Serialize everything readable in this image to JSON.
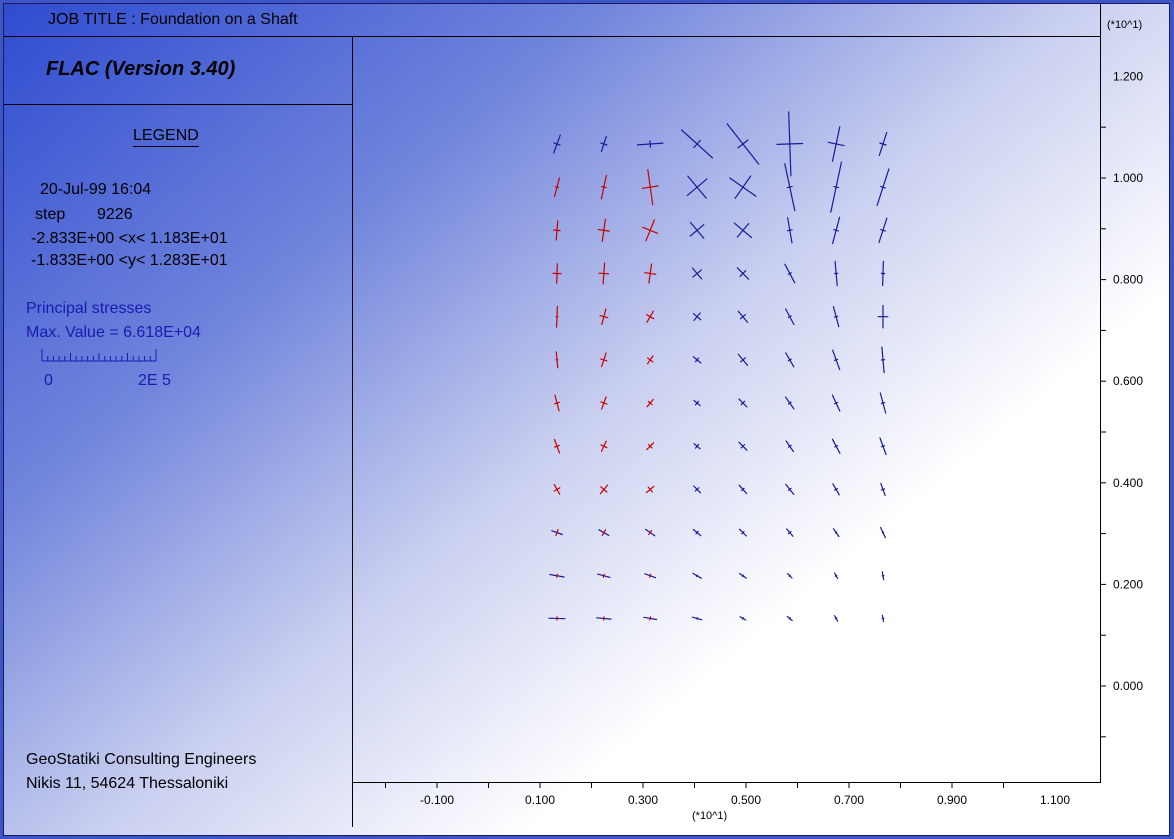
{
  "header": {
    "job_title": "JOB TITLE :   Foundation on a Shaft",
    "program": "FLAC (Version 3.40)"
  },
  "legend": {
    "heading": "LEGEND",
    "date_time": "20-Jul-99  16:04",
    "step_label": "step",
    "step_value": "9226",
    "x_range": "-2.833E+00 <x<  1.183E+01",
    "y_range": "-1.833E+00 <y<  1.283E+01",
    "stress_title": "Principal stresses",
    "max_value": "Max. Value =   6.618E+04",
    "scale_min": "0",
    "scale_max": "2E  5"
  },
  "footer": {
    "company": "GeoStatiki Consulting Engineers",
    "address": "Nikis 11, 54624 Thessaloniki"
  },
  "colors": {
    "compression": "#1a1a9a",
    "tension": "#c80000"
  },
  "chart_data": {
    "type": "vector-field",
    "title": "Principal stresses",
    "x_multiplier_label": "(*10^1)",
    "y_multiplier_label": "(*10^1)",
    "x_ticks": [
      "-0.100",
      "0.100",
      "0.300",
      "0.500",
      "0.700",
      "0.900",
      "1.100"
    ],
    "y_ticks": [
      "0.000",
      "0.200",
      "0.400",
      "0.600",
      "0.800",
      "1.000",
      "1.200"
    ],
    "xlim": [
      -0.283,
      1.183
    ],
    "ylim": [
      -0.183,
      1.283
    ],
    "grid_x": [
      0.133,
      0.224,
      0.314,
      0.405,
      0.494,
      0.585,
      0.675,
      0.766
    ],
    "grid_y": [
      0.133,
      0.217,
      0.302,
      0.387,
      0.472,
      0.557,
      0.642,
      0.727,
      0.812,
      0.897,
      0.982,
      1.067
    ],
    "scale_max_value": 200000,
    "rows": [
      [
        {
          "s1": [
            1.2,
            20,
            0
          ],
          "s2": [
            0.4,
            110,
            0
          ]
        },
        {
          "s1": [
            1.0,
            18,
            0
          ],
          "s2": [
            0.4,
            108,
            0
          ]
        },
        {
          "s1": [
            1.6,
            86,
            0
          ],
          "s2": [
            0.4,
            176,
            0
          ]
        },
        {
          "s1": [
            2.6,
            -48,
            0
          ],
          "s2": [
            0.6,
            42,
            0
          ]
        },
        {
          "s1": [
            3.2,
            -38,
            0
          ],
          "s2": [
            0.8,
            52,
            0
          ]
        },
        {
          "s1": [
            4.0,
            -2,
            0
          ],
          "s2": [
            1.6,
            88,
            0
          ]
        },
        {
          "s1": [
            2.2,
            12,
            0
          ],
          "s2": [
            1.0,
            102,
            0
          ]
        },
        {
          "s1": [
            1.5,
            18,
            0
          ],
          "s2": [
            0.4,
            108,
            0
          ]
        }
      ],
      [
        {
          "s1": [
            1.2,
            15,
            1
          ],
          "s2": [
            0.2,
            105,
            1
          ]
        },
        {
          "s1": [
            1.5,
            12,
            1
          ],
          "s2": [
            0.3,
            102,
            1
          ]
        },
        {
          "s1": [
            2.2,
            -8,
            1
          ],
          "s2": [
            1.0,
            82,
            1
          ]
        },
        {
          "s1": [
            1.8,
            -40,
            0
          ],
          "s2": [
            1.6,
            50,
            0
          ]
        },
        {
          "s1": [
            2.0,
            -55,
            0
          ],
          "s2": [
            1.7,
            35,
            0
          ]
        },
        {
          "s1": [
            3.0,
            -12,
            0
          ],
          "s2": [
            0.3,
            78,
            0
          ]
        },
        {
          "s1": [
            3.2,
            12,
            0
          ],
          "s2": [
            0.3,
            102,
            0
          ]
        },
        {
          "s1": [
            2.4,
            18,
            0
          ],
          "s2": [
            0.3,
            108,
            0
          ]
        }
      ],
      [
        {
          "s1": [
            1.2,
            5,
            1
          ],
          "s2": [
            0.4,
            95,
            1
          ]
        },
        {
          "s1": [
            1.4,
            8,
            1
          ],
          "s2": [
            0.7,
            98,
            1
          ]
        },
        {
          "s1": [
            1.4,
            22,
            1
          ],
          "s2": [
            1.0,
            112,
            1
          ]
        },
        {
          "s1": [
            1.3,
            -40,
            0
          ],
          "s2": [
            1.1,
            50,
            0
          ]
        },
        {
          "s1": [
            1.4,
            -50,
            0
          ],
          "s2": [
            1.1,
            40,
            0
          ]
        },
        {
          "s1": [
            1.6,
            -10,
            0
          ],
          "s2": [
            0.3,
            80,
            0
          ]
        },
        {
          "s1": [
            1.7,
            15,
            0
          ],
          "s2": [
            0.3,
            105,
            0
          ]
        },
        {
          "s1": [
            1.6,
            18,
            0
          ],
          "s2": [
            0.3,
            108,
            0
          ]
        }
      ],
      [
        {
          "s1": [
            1.2,
            2,
            1
          ],
          "s2": [
            0.5,
            92,
            1
          ]
        },
        {
          "s1": [
            1.3,
            4,
            1
          ],
          "s2": [
            0.6,
            94,
            1
          ]
        },
        {
          "s1": [
            1.2,
            8,
            1
          ],
          "s2": [
            0.7,
            98,
            1
          ]
        },
        {
          "s1": [
            0.9,
            -40,
            0
          ],
          "s2": [
            0.7,
            50,
            0
          ]
        },
        {
          "s1": [
            1.0,
            -45,
            0
          ],
          "s2": [
            0.5,
            45,
            0
          ]
        },
        {
          "s1": [
            1.3,
            -28,
            0
          ],
          "s2": [
            0.2,
            62,
            0
          ]
        },
        {
          "s1": [
            1.5,
            -5,
            0
          ],
          "s2": [
            0.2,
            85,
            0
          ]
        },
        {
          "s1": [
            1.5,
            2,
            0
          ],
          "s2": [
            0.2,
            92,
            0
          ]
        }
      ],
      [
        {
          "s1": [
            1.3,
            2,
            1
          ],
          "s2": [
            0.1,
            92,
            1
          ]
        },
        {
          "s1": [
            1.0,
            15,
            1
          ],
          "s2": [
            0.5,
            105,
            1
          ]
        },
        {
          "s1": [
            0.8,
            30,
            1
          ],
          "s2": [
            0.5,
            120,
            1
          ]
        },
        {
          "s1": [
            0.6,
            -50,
            0
          ],
          "s2": [
            0.6,
            40,
            0
          ]
        },
        {
          "s1": [
            0.9,
            -40,
            0
          ],
          "s2": [
            0.4,
            50,
            0
          ]
        },
        {
          "s1": [
            1.1,
            -28,
            0
          ],
          "s2": [
            0.2,
            62,
            0
          ]
        },
        {
          "s1": [
            1.3,
            -15,
            0
          ],
          "s2": [
            0.2,
            75,
            0
          ]
        },
        {
          "s1": [
            1.4,
            0,
            0
          ],
          "s2": [
            0.6,
            90,
            0
          ]
        }
      ],
      [
        {
          "s1": [
            1.0,
            -5,
            1
          ],
          "s2": [
            0.1,
            85,
            1
          ]
        },
        {
          "s1": [
            0.9,
            18,
            1
          ],
          "s2": [
            0.4,
            108,
            1
          ]
        },
        {
          "s1": [
            0.6,
            35,
            1
          ],
          "s2": [
            0.4,
            125,
            1
          ]
        },
        {
          "s1": [
            0.6,
            -50,
            0
          ],
          "s2": [
            0.3,
            40,
            0
          ]
        },
        {
          "s1": [
            0.9,
            -40,
            0
          ],
          "s2": [
            0.4,
            50,
            0
          ]
        },
        {
          "s1": [
            1.0,
            -30,
            0
          ],
          "s2": [
            0.2,
            60,
            0
          ]
        },
        {
          "s1": [
            1.3,
            -20,
            0
          ],
          "s2": [
            0.2,
            70,
            0
          ]
        },
        {
          "s1": [
            1.6,
            -5,
            0
          ],
          "s2": [
            0.2,
            85,
            0
          ]
        }
      ],
      [
        {
          "s1": [
            1.0,
            -15,
            1
          ],
          "s2": [
            0.3,
            75,
            1
          ]
        },
        {
          "s1": [
            0.8,
            20,
            1
          ],
          "s2": [
            0.4,
            110,
            1
          ]
        },
        {
          "s1": [
            0.6,
            40,
            1
          ],
          "s2": [
            0.3,
            130,
            1
          ]
        },
        {
          "s1": [
            0.5,
            -50,
            0
          ],
          "s2": [
            0.3,
            40,
            0
          ]
        },
        {
          "s1": [
            0.7,
            -45,
            0
          ],
          "s2": [
            0.3,
            45,
            0
          ]
        },
        {
          "s1": [
            0.9,
            -35,
            0
          ],
          "s2": [
            0.2,
            55,
            0
          ]
        },
        {
          "s1": [
            1.1,
            -25,
            0
          ],
          "s2": [
            0.2,
            65,
            0
          ]
        },
        {
          "s1": [
            1.3,
            -15,
            0
          ],
          "s2": [
            0.2,
            75,
            0
          ]
        }
      ],
      [
        {
          "s1": [
            0.9,
            -20,
            1
          ],
          "s2": [
            0.3,
            70,
            1
          ]
        },
        {
          "s1": [
            0.7,
            25,
            1
          ],
          "s2": [
            0.4,
            115,
            1
          ]
        },
        {
          "s1": [
            0.6,
            45,
            1
          ],
          "s2": [
            0.3,
            135,
            1
          ]
        },
        {
          "s1": [
            0.5,
            -50,
            0
          ],
          "s2": [
            0.3,
            40,
            0
          ]
        },
        {
          "s1": [
            0.7,
            -45,
            0
          ],
          "s2": [
            0.3,
            45,
            0
          ]
        },
        {
          "s1": [
            0.8,
            -35,
            0
          ],
          "s2": [
            0.2,
            55,
            0
          ]
        },
        {
          "s1": [
            1.0,
            -28,
            0
          ],
          "s2": [
            0.2,
            62,
            0
          ]
        },
        {
          "s1": [
            1.1,
            -20,
            0
          ],
          "s2": [
            0.2,
            70,
            0
          ]
        }
      ],
      [
        {
          "s1": [
            0.7,
            -30,
            1
          ],
          "s2": [
            0.4,
            60,
            1
          ]
        },
        {
          "s1": [
            0.7,
            40,
            1
          ],
          "s2": [
            0.5,
            130,
            1
          ]
        },
        {
          "s1": [
            0.6,
            50,
            1
          ],
          "s2": [
            0.4,
            140,
            1
          ]
        },
        {
          "s1": [
            0.6,
            -45,
            0
          ],
          "s2": [
            0.3,
            45,
            0
          ]
        },
        {
          "s1": [
            0.7,
            -42,
            0
          ],
          "s2": [
            0.2,
            48,
            0
          ]
        },
        {
          "s1": [
            0.8,
            -38,
            0
          ],
          "s2": [
            0.2,
            52,
            0
          ]
        },
        {
          "s1": [
            0.8,
            -30,
            0
          ],
          "s2": [
            0.2,
            60,
            0
          ]
        },
        {
          "s1": [
            0.8,
            -20,
            0
          ],
          "s2": [
            0.2,
            70,
            0
          ]
        }
      ],
      [
        {
          "s1": [
            0.7,
            -70,
            0
          ],
          "s2": [
            0.4,
            20,
            1
          ]
        },
        {
          "s1": [
            0.7,
            -60,
            0
          ],
          "s2": [
            0.4,
            30,
            1
          ]
        },
        {
          "s1": [
            0.7,
            -55,
            0
          ],
          "s2": [
            0.3,
            35,
            1
          ]
        },
        {
          "s1": [
            0.6,
            -50,
            0
          ],
          "s2": [
            0.2,
            40,
            0
          ]
        },
        {
          "s1": [
            0.6,
            -45,
            0
          ],
          "s2": [
            0.2,
            45,
            0
          ]
        },
        {
          "s1": [
            0.6,
            -40,
            0
          ],
          "s2": [
            0.2,
            50,
            0
          ]
        },
        {
          "s1": [
            0.6,
            -35,
            0
          ],
          "s2": [
            0.1,
            55,
            0
          ]
        },
        {
          "s1": [
            0.7,
            -25,
            0
          ],
          "s2": [
            0.1,
            65,
            0
          ]
        }
      ],
      [
        {
          "s1": [
            0.9,
            -80,
            0
          ],
          "s2": [
            0.2,
            10,
            1
          ]
        },
        {
          "s1": [
            0.8,
            -75,
            0
          ],
          "s2": [
            0.2,
            15,
            1
          ]
        },
        {
          "s1": [
            0.7,
            -70,
            0
          ],
          "s2": [
            0.2,
            20,
            1
          ]
        },
        {
          "s1": [
            0.6,
            -60,
            0
          ],
          "s2": [
            0.1,
            30,
            0
          ]
        },
        {
          "s1": [
            0.5,
            -55,
            0
          ],
          "s2": [
            0.1,
            35,
            0
          ]
        },
        {
          "s1": [
            0.4,
            -45,
            0
          ],
          "s2": [
            0.1,
            45,
            0
          ]
        },
        {
          "s1": [
            0.4,
            -30,
            0
          ],
          "s2": [
            0.1,
            60,
            0
          ]
        },
        {
          "s1": [
            0.5,
            -10,
            0
          ],
          "s2": [
            0.1,
            80,
            0
          ]
        }
      ],
      [
        {
          "s1": [
            1.0,
            -88,
            0
          ],
          "s2": [
            0.2,
            2,
            1
          ]
        },
        {
          "s1": [
            0.9,
            -85,
            0
          ],
          "s2": [
            0.2,
            5,
            1
          ]
        },
        {
          "s1": [
            0.8,
            -80,
            0
          ],
          "s2": [
            0.2,
            10,
            1
          ]
        },
        {
          "s1": [
            0.6,
            -75,
            0
          ],
          "s2": [
            0.1,
            15,
            0
          ]
        },
        {
          "s1": [
            0.4,
            -60,
            0
          ],
          "s2": [
            0.1,
            30,
            0
          ]
        },
        {
          "s1": [
            0.4,
            -50,
            0
          ],
          "s2": [
            0.1,
            40,
            0
          ]
        },
        {
          "s1": [
            0.4,
            -30,
            0
          ],
          "s2": [
            0.1,
            60,
            0
          ]
        },
        {
          "s1": [
            0.4,
            -10,
            0
          ],
          "s2": [
            0.1,
            80,
            0
          ]
        }
      ]
    ]
  }
}
